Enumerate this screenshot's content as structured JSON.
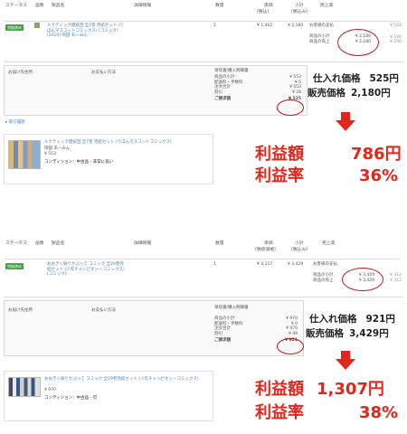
{
  "order1": {
    "headers": {
      "status": "ステータス",
      "pic": "画像",
      "title": "製品名",
      "detail": "詳細情報",
      "qty": "数量",
      "unit_price": "単価",
      "unit_price_sub": "(税込)",
      "subtotal": "小計",
      "subtotal_sub": "(税込み)",
      "sales": "売上高"
    },
    "status_badge": "完納済み",
    "product": "ルナティック雑技団 全7巻 完結セット (りぼんマスコットコミックス) [コミック] [2010] 岡田 あーみん",
    "qty": "1",
    "unit_price": "¥ 1,462",
    "subtotal": "¥ 2,180",
    "sales_list": [
      {
        "label": "お客様の支払",
        "value": ""
      },
      {
        "label": "商品の小計",
        "value": "¥ 2,180"
      },
      {
        "label": "商品の売上",
        "value": "¥ 2,180"
      }
    ],
    "sales_right": [
      "¥ 168",
      "¥ 190",
      "¥ 190"
    ],
    "payment_header": "お届け先住所",
    "payment_method": "お支払い方法",
    "receipt_header": "領収書/購入明細書",
    "receipt_rows": [
      {
        "label": "商品の小計",
        "value": "¥ 553"
      },
      {
        "label": "配送料・手数料",
        "value": "¥ 0"
      },
      {
        "label": "注文合計",
        "value": "¥ 553"
      },
      {
        "label": "割引",
        "value": "¥ 28"
      },
      {
        "label": "ご請求額",
        "value": "¥ 525"
      }
    ],
    "history_link": "▸ 取引履歴",
    "item_title": "ルナティック雑技団 全7巻 完結セット (りぼんマスコットコミックス)",
    "item_author": "岡田 あーみん",
    "item_price": "¥ 553",
    "item_condition": "コンディション：中古品 - 非常に良い",
    "purchase_price_label": "仕入れ価格",
    "purchase_price": "525円",
    "sale_price_label": "販売価格",
    "sale_price": "2,180円",
    "profit_label": "利益額",
    "profit": "786円",
    "margin_label": "利益率",
    "margin": "36%"
  },
  "order2": {
    "headers": {
      "status": "ステータス",
      "pic": "画像",
      "title": "製品名",
      "detail": "詳細情報",
      "qty": "数量",
      "unit_price": "単価",
      "unit_price_sub": "(税抜価格)",
      "subtotal": "小計",
      "subtotal_sub": "(税込み)",
      "sales": "売上高"
    },
    "status_badge": "完納済み",
    "product": "おおきく振りかぶって コミック 全29巻完結セット (少年チャンピオン・コミックス) [コミック]",
    "qty": "1",
    "unit_price": "¥ 3,117",
    "subtotal": "¥ 3,429",
    "sales_list": [
      {
        "label": "お客様の支払",
        "value": ""
      },
      {
        "label": "商品の小計",
        "value": "¥ 3,429"
      },
      {
        "label": "商品の売上",
        "value": "¥ 3,429"
      }
    ],
    "sales_right": [
      "¥ 312",
      "¥ 312"
    ],
    "payment_header": "お届け先住所",
    "payment_method": "お支払い方法",
    "receipt_header": "領収書/購入明細書",
    "receipt_rows": [
      {
        "label": "商品の小計",
        "value": "¥ 970"
      },
      {
        "label": "配送料・手数料",
        "value": "¥ 0"
      },
      {
        "label": "注文合計",
        "value": "¥ 970"
      },
      {
        "label": "割引",
        "value": "¥ 49"
      },
      {
        "label": "ご請求額",
        "value": "¥ 921"
      }
    ],
    "item_title": "おおきく振りかぶって コミック 全29巻完結セット (少年チャンピオン・コミックス)",
    "item_author": "",
    "item_price": "¥ 970",
    "item_condition": "コンディション：中古品 - 可",
    "purchase_price_label": "仕入れ価格",
    "purchase_price": "921円",
    "sale_price_label": "販売価格",
    "sale_price": "3,429円",
    "profit_label": "利益額",
    "profit": "1,307円",
    "margin_label": "利益率",
    "margin": "38%"
  }
}
